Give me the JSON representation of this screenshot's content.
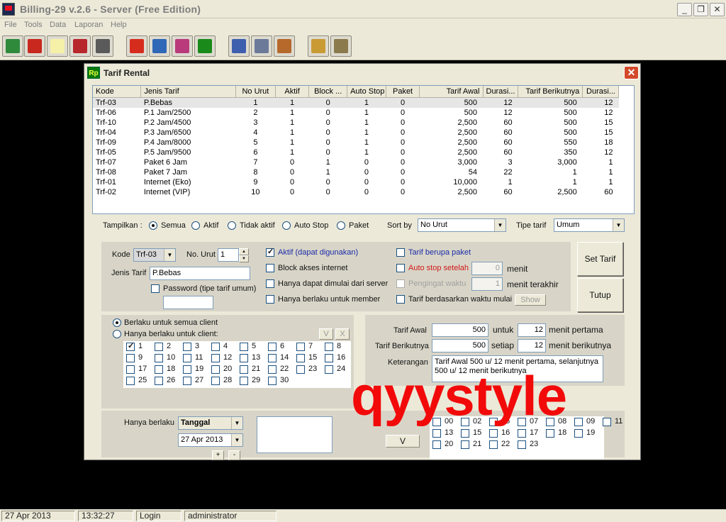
{
  "app": {
    "title": "Billing-29 v.2.6 - Server (Free Edition)",
    "window_buttons": [
      "_",
      "❐",
      "✕"
    ]
  },
  "menu": [
    "File",
    "Tools",
    "Data",
    "Laporan",
    "Help"
  ],
  "toolbar": [
    {
      "icon": "client-map-icon",
      "color": "#2f8a3c"
    },
    {
      "icon": "key-icon",
      "color": "#c8281e"
    },
    {
      "icon": "notepad-icon",
      "color": "#f6f1a8"
    },
    {
      "icon": "eraser-icon",
      "color": "#b8272b"
    },
    {
      "icon": "close-x-icon",
      "color": "#5a5a5a"
    },
    {
      "icon": "no-sign-icon",
      "color": "#d62c1e"
    },
    {
      "icon": "client-setting-icon",
      "color": "#2e68b7"
    },
    {
      "icon": "server-setting-icon",
      "color": "#b93b7c"
    },
    {
      "icon": "rp-tariff-icon",
      "color": "#1a8a1a"
    },
    {
      "icon": "member-icon",
      "color": "#3d5fae"
    },
    {
      "icon": "operator-icon",
      "color": "#6c7a9a"
    },
    {
      "icon": "food-icon",
      "color": "#b5692a"
    },
    {
      "icon": "home-icon",
      "color": "#c99b35"
    },
    {
      "icon": "report-rp-icon",
      "color": "#8a7a4c"
    }
  ],
  "dialog": {
    "title": "Tarif Rental",
    "rp_badge": "Rp",
    "close": "✕"
  },
  "table": {
    "columns": [
      "Kode",
      "Jenis Tarif",
      "No Urut",
      "Aktif",
      "Block ...",
      "Auto Stop",
      "Paket",
      "Tarif Awal",
      "Durasi...",
      "Tarif Berikutnya",
      "Durasi..."
    ],
    "rows": [
      [
        "Trf-03",
        "P.Bebas",
        "1",
        "1",
        "0",
        "1",
        "0",
        "500",
        "12",
        "500",
        "12"
      ],
      [
        "Trf-06",
        "P.1 Jam/2500",
        "2",
        "1",
        "0",
        "1",
        "0",
        "500",
        "12",
        "500",
        "12"
      ],
      [
        "Trf-10",
        "P.2 Jam/4500",
        "3",
        "1",
        "0",
        "1",
        "0",
        "2,500",
        "60",
        "500",
        "15"
      ],
      [
        "Trf-04",
        "P.3 Jam/6500",
        "4",
        "1",
        "0",
        "1",
        "0",
        "2,500",
        "60",
        "500",
        "15"
      ],
      [
        "Trf-09",
        "P.4 Jam/8000",
        "5",
        "1",
        "0",
        "1",
        "0",
        "2,500",
        "60",
        "550",
        "18"
      ],
      [
        "Trf-05",
        "P.5 Jam/9500",
        "6",
        "1",
        "0",
        "1",
        "0",
        "2,500",
        "60",
        "350",
        "12"
      ],
      [
        "Trf-07",
        "Paket 6 Jam",
        "7",
        "0",
        "1",
        "0",
        "0",
        "3,000",
        "3",
        "3,000",
        "1"
      ],
      [
        "Trf-08",
        "Paket 7 Jam",
        "8",
        "0",
        "1",
        "0",
        "0",
        "54",
        "22",
        "1",
        "1"
      ],
      [
        "Trf-01",
        "Internet (Eko)",
        "9",
        "0",
        "0",
        "0",
        "0",
        "10,000",
        "1",
        "1",
        "1"
      ],
      [
        "Trf-02",
        "Internet (VIP)",
        "10",
        "0",
        "0",
        "0",
        "0",
        "2,500",
        "60",
        "2,500",
        "60"
      ]
    ],
    "selected_row": 0
  },
  "filter": {
    "tampilkan_label": "Tampilkan :",
    "options": [
      "Semua",
      "Aktif",
      "Tidak aktif",
      "Auto Stop",
      "Paket"
    ],
    "selected": 0,
    "sort_label": "Sort by",
    "sort_value": "No Urut",
    "tipe_label": "Tipe tarif",
    "tipe_value": "Umum"
  },
  "form": {
    "kode_label": "Kode",
    "kode_value": "Trf-03",
    "no_urut_label": "No. Urut",
    "no_urut_value": "1",
    "jenis_label": "Jenis Tarif",
    "jenis_value": "P.Bebas",
    "password_label": "Password (tipe tarif umum)",
    "password_value": "",
    "aktif_label": "Aktif (dapat digunakan)",
    "block_label": "Block akses internet",
    "dimulai_label": "Hanya dapat dimulai dari server",
    "member_label": "Hanya berlaku untuk member",
    "paket_label": "Tarif berupa paket",
    "autostop_label": "Auto stop setelah",
    "autostop_value": "0",
    "autostop_unit": "menit",
    "pengingat_label": "Pengingat waktu",
    "pengingat_value": "1",
    "pengingat_unit": "menit terakhir",
    "waktu_mulai_label": "Tarif berdasarkan waktu mulai",
    "show_label": "Show",
    "set_tarif_label": "Set Tarif",
    "tutup_label": "Tutup"
  },
  "clients": {
    "semua_label": "Berlaku untuk semua client",
    "hanya_label": "Hanya berlaku untuk client:",
    "check_all": "V",
    "clear_all": "X",
    "items": [
      "1",
      "2",
      "3",
      "4",
      "5",
      "6",
      "7",
      "8",
      "9",
      "10",
      "11",
      "12",
      "13",
      "14",
      "15",
      "16",
      "17",
      "18",
      "19",
      "20",
      "21",
      "22",
      "23",
      "24",
      "25",
      "26",
      "27",
      "28",
      "29",
      "30"
    ],
    "checked": [
      "1"
    ]
  },
  "tarif": {
    "awal_label": "Tarif Awal",
    "awal_value": "500",
    "untuk_label": "untuk",
    "awal_durasi": "12",
    "awal_unit": "menit pertama",
    "berikut_label": "Tarif Berikutnya",
    "berikut_value": "500",
    "setiap_label": "setiap",
    "berikut_durasi": "12",
    "berikut_unit": "menit berikutnya",
    "keterangan_label": "Keterangan",
    "keterangan_value": "Tarif Awal 500 u/ 12 menit pertama, selanjutnya 500 u/ 12 menit berikutnya"
  },
  "berlaku": {
    "label": "Hanya berlaku",
    "mode": "Tanggal",
    "date": "27 Apr 2013",
    "plus": "+",
    "minus": "-",
    "v_button": "V",
    "hours": [
      "00",
      "02",
      "05",
      "07",
      "08",
      "09",
      "11",
      "13",
      "15",
      "16",
      "17",
      "18",
      "19",
      "20",
      "21",
      "22",
      "23"
    ]
  },
  "watermark": "qyystyle",
  "status": {
    "date": "27 Apr 2013",
    "time": "13:32:27",
    "login_label": "Login",
    "user": "administrator"
  }
}
